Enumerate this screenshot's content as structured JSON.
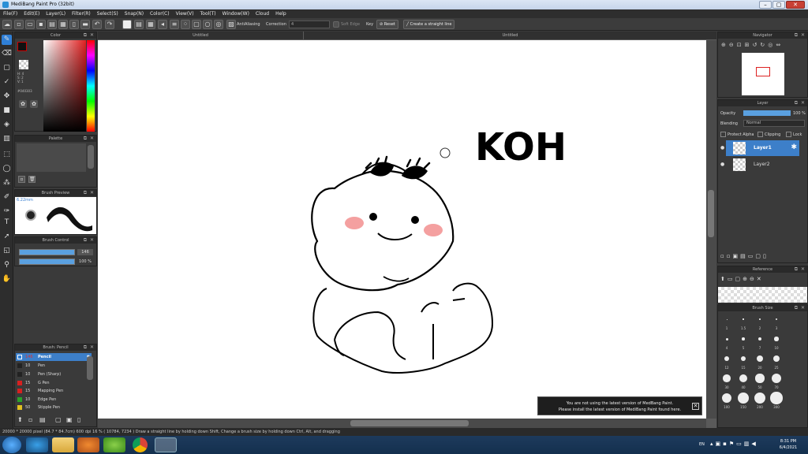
{
  "window": {
    "title": "MediBang Paint Pro (32bit)",
    "controls": [
      "–",
      "▢",
      "✕"
    ]
  },
  "menu": [
    "File(F)",
    "Edit(E)",
    "Layer(L)",
    "Filter(R)",
    "Select(S)",
    "Snap(N)",
    "Color(C)",
    "View(V)",
    "Tool(T)",
    "Window(W)",
    "Cloud",
    "Help"
  ],
  "toolbar": {
    "antialiasing": "AntiAliasing",
    "correction_label": "Correction",
    "correction_value": "4",
    "soft_edge": "Soft Edge",
    "key_label": "Key",
    "reset": "Reset",
    "straight_line": "Create a straight line"
  },
  "tabs": {
    "left": "Untitled",
    "right": "Untitled"
  },
  "color_panel": {
    "title": "Color",
    "h": "H: 4",
    "s": "S: 2",
    "v": "V: 1",
    "hex": "#040303"
  },
  "palette_panel": {
    "title": "Palette"
  },
  "brush_preview": {
    "title": "Brush Preview",
    "size": "6.22mm"
  },
  "brush_control": {
    "title": "Brush Control",
    "size_value": "146",
    "opacity_value": "100 %"
  },
  "brush_panel": {
    "title": "Brush: Pencil",
    "items": [
      {
        "size": "146",
        "name": "Pencil",
        "color": "#2f7fd6"
      },
      {
        "size": "10",
        "name": "Pen",
        "color": "#222222"
      },
      {
        "size": "10",
        "name": "Pen (Sharp)",
        "color": "#222222"
      },
      {
        "size": "15",
        "name": "G Pen",
        "color": "#d62020"
      },
      {
        "size": "15",
        "name": "Mapping Pen",
        "color": "#d62020"
      },
      {
        "size": "10",
        "name": "Edge Pen",
        "color": "#2aa12a"
      },
      {
        "size": "50",
        "name": "Stipple Pen",
        "color": "#e0c020"
      }
    ]
  },
  "navigator": {
    "title": "Navigator"
  },
  "layer_panel": {
    "title": "Layer",
    "opacity_label": "Opacity",
    "opacity_value": "100 %",
    "blending_label": "Blending",
    "blending_value": "Normal",
    "protect_alpha": "Protect Alpha",
    "clipping": "Clipping",
    "lock": "Lock",
    "layers": [
      "Layer1",
      "Layer2"
    ]
  },
  "reference_panel": {
    "title": "Reference"
  },
  "brush_size_panel": {
    "title": "Brush Size",
    "labels": [
      "1",
      "1.5",
      "2",
      "3",
      "4",
      "5",
      "7",
      "10",
      "12",
      "15",
      "20",
      "25",
      "30",
      "40",
      "50",
      "70",
      "100",
      "150",
      "200",
      "300"
    ]
  },
  "canvas_text": "KOH",
  "notification": {
    "line1": "You are not using the latest version of MedBang Paint.",
    "line2": "Please install the latest version of MediBang Paint found here."
  },
  "status": "20000 * 20000 pixel   (84.7 * 84.7cm)   600 dpi   16 %   ( 10784, 7234 )   Draw a straight line by holding down Shift, Change a brush size by holding down Ctrl, Alt, and dragging",
  "clock": {
    "time": "8:31 PM",
    "date": "6/4/2021"
  },
  "tray": {
    "lang": "EN"
  },
  "colors": {
    "accent": "#4a90d9",
    "selected_layer": "#3d7fc9"
  }
}
